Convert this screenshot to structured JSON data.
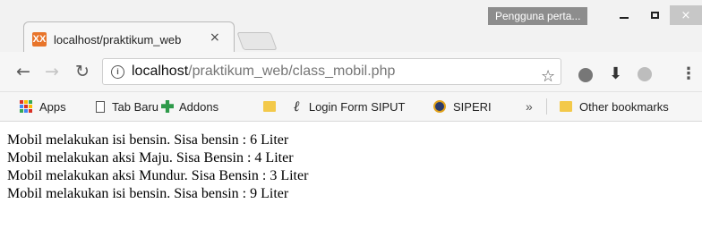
{
  "window": {
    "profile_label": "Pengguna perta...",
    "close_glyph": "×"
  },
  "tab": {
    "title": "localhost/praktikum_web",
    "close_glyph": "×",
    "favicon_letter": "XX"
  },
  "toolbar": {
    "url_host": "localhost",
    "url_path": "/praktikum_web/class_mobil.php",
    "back_icon": "arrow-left-icon",
    "forward_icon": "arrow-right-icon",
    "reload_icon": "reload-icon",
    "info_icon": "info-icon",
    "star_icon": "star-icon",
    "download_icon": "download-icon",
    "menu_icon": "vertical-dots-icon"
  },
  "bookmarks": {
    "items": [
      {
        "label": "Apps",
        "icon": "apps-grid-icon"
      },
      {
        "label": "Tab Baru",
        "icon": "page-icon"
      },
      {
        "label": "Addons",
        "icon": "puzzle-icon"
      },
      {
        "label": "",
        "icon": "folder-icon"
      },
      {
        "label": "Login Form SIPUT",
        "icon": "l-logo-icon"
      },
      {
        "label": "SIPERI",
        "icon": "owl-icon"
      }
    ],
    "overflow": "»",
    "other_bookmarks": "Other bookmarks"
  },
  "content": {
    "lines": [
      "Mobil melakukan isi bensin. Sisa bensin : 6 Liter",
      "Mobil melakukan aksi Maju. Sisa Bensin : 4 Liter",
      "Mobil melakukan aksi Mundur. Sisa Bensin : 3 Liter",
      "Mobil melakukan isi bensin. Sisa bensin : 9 Liter"
    ]
  }
}
